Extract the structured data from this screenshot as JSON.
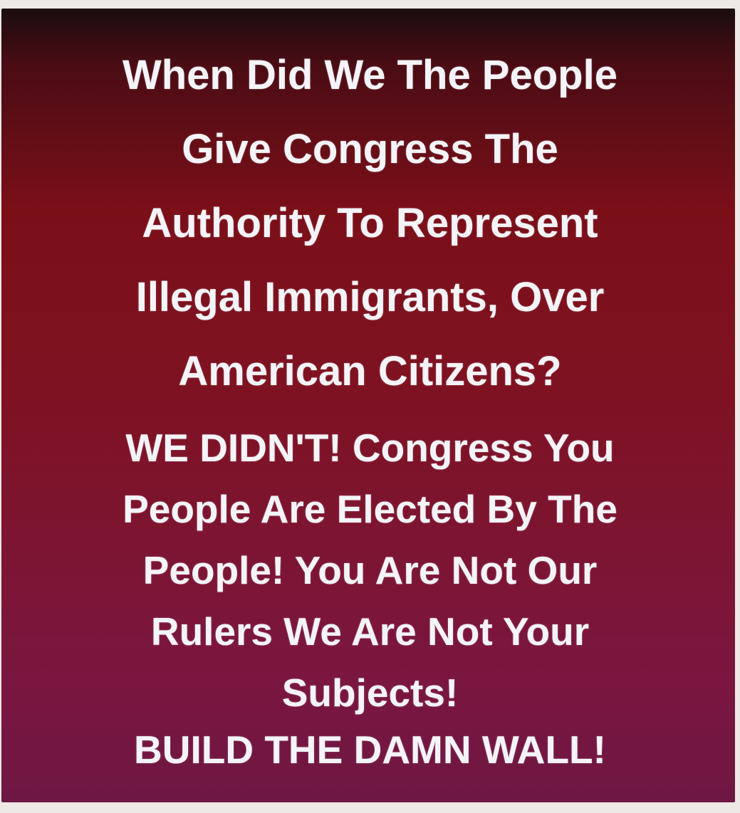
{
  "question": {
    "lines": [
      "When Did We The People",
      "Give Congress The",
      "Authority To Represent",
      "Illegal Immigrants, Over",
      "American Citizens?"
    ]
  },
  "answer": {
    "lines": [
      "WE DIDN'T! Congress You",
      "People Are Elected By The",
      "People! You Are Not Our",
      "Rulers We Are Not Your",
      "Subjects!"
    ]
  },
  "closing": {
    "line": "BUILD THE DAMN WALL!"
  },
  "colors": {
    "text": "#f4f4f8",
    "background_top": "#7a0f18",
    "background_bottom": "#6e1743"
  }
}
